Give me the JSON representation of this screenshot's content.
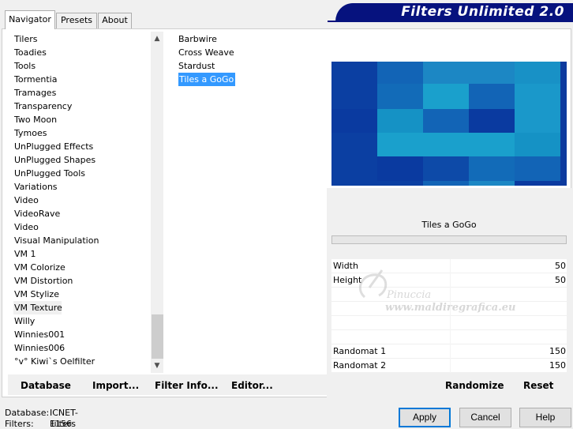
{
  "tabs": [
    {
      "label": "Navigator",
      "active": true
    },
    {
      "label": "Presets",
      "active": false
    },
    {
      "label": "About",
      "active": false
    }
  ],
  "banner": {
    "title": "Filters Unlimited 2.0",
    "color": "#06127e"
  },
  "categories": {
    "items": [
      "Tilers",
      "Toadies",
      "Tools",
      "Tormentia",
      "Tramages",
      "Transparency",
      "Two Moon",
      "Tymoes",
      "UnPlugged Effects",
      "UnPlugged Shapes",
      "UnPlugged Tools",
      "Variations",
      "Video",
      "VideoRave",
      "Video",
      "Visual Manipulation",
      "VM 1",
      "VM Colorize",
      "VM Distortion",
      "VM Stylize",
      "VM Texture",
      "Willy",
      "Winnies001",
      "Winnies006",
      "°v° Kiwi`s Oelfilter"
    ],
    "selected": "VM Texture"
  },
  "filters": {
    "items": [
      "Barbwire",
      "Cross Weave",
      "Stardust",
      "Tiles a GoGo"
    ],
    "selected": "Tiles a GoGo"
  },
  "preview": {
    "colors": [
      [
        "#0b3fa2",
        "#1264b6",
        "#1c87c4",
        "#1c87c4",
        "#1891c6",
        "#0d3a9e"
      ],
      [
        "#0b3fa2",
        "#126bb8",
        "#1aa0cc",
        "#1264b6",
        "#1a98ca",
        "#0d3a9e"
      ],
      [
        "#0a3aa0",
        "#1592c5",
        "#1264b6",
        "#0a3aa0",
        "#1a98ca",
        "#0d3a9e"
      ],
      [
        "#0b3fa2",
        "#1aa0cc",
        "#1aa0cc",
        "#1aa0cc",
        "#1592c5",
        "#0d3a9e"
      ],
      [
        "#0b3fa2",
        "#0a3aa0",
        "#0d4aa8",
        "#126bb8",
        "#1264b6",
        "#0d3a9e"
      ],
      [
        "#0b3fa2",
        "#0b3fa2",
        "#1264b6",
        "#1c87c4",
        "#0a3aa0",
        "#0d3a9e"
      ]
    ]
  },
  "current_filter": "Tiles a GoGo",
  "params": [
    {
      "label": "Width",
      "value": "50"
    },
    {
      "label": "Height",
      "value": "50"
    },
    {
      "label": "",
      "value": ""
    },
    {
      "label": "",
      "value": ""
    },
    {
      "label": "",
      "value": ""
    },
    {
      "label": "",
      "value": ""
    },
    {
      "label": "Randomat 1",
      "value": "150"
    },
    {
      "label": "Randomat 2",
      "value": "150"
    }
  ],
  "watermark": {
    "name": "Pinuccia",
    "url": "www.maldiregrafica.eu"
  },
  "left_buttons": {
    "database": "Database",
    "import": "Import...",
    "filter_info": "Filter Info...",
    "editor": "Editor..."
  },
  "right_buttons": {
    "randomize": "Randomize",
    "reset": "Reset"
  },
  "status": {
    "database_label": "Database:",
    "database_value": "ICNET-Filters",
    "filters_label": "Filters:",
    "filters_value": "1156"
  },
  "dialog_buttons": {
    "apply": "Apply",
    "cancel": "Cancel",
    "help": "Help"
  },
  "accent_color": "#0078d7"
}
